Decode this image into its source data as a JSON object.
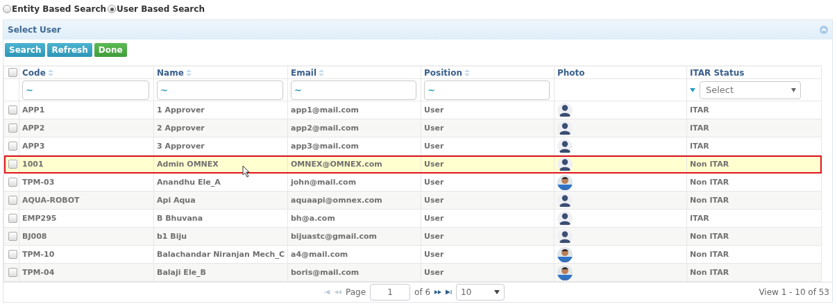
{
  "search_mode": [
    {
      "label": "Entity Based Search",
      "selected": false
    },
    {
      "label": "User Based Search",
      "selected": true
    }
  ],
  "panel": {
    "title": "Select User"
  },
  "buttons": [
    {
      "label": "Search",
      "kind": "primary"
    },
    {
      "label": "Refresh",
      "kind": "primary"
    },
    {
      "label": "Done",
      "kind": "success"
    }
  ],
  "table": {
    "select_all_checked": false,
    "columns": [
      {
        "label": "Code",
        "sortable": true,
        "kind": "text",
        "value": "~"
      },
      {
        "label": "Name",
        "sortable": true,
        "kind": "text",
        "value": "~"
      },
      {
        "label": "Email",
        "sortable": true,
        "kind": "text",
        "value": "~"
      },
      {
        "label": "Position",
        "sortable": true,
        "kind": "text",
        "value": "~"
      },
      {
        "label": "Photo",
        "sortable": false,
        "kind": "blank"
      },
      {
        "label": "ITAR Status",
        "sortable": false,
        "kind": "select",
        "placeholder": "Select"
      }
    ],
    "rows": [
      {
        "checked": false,
        "selected": false,
        "code": "APP1",
        "name": "1 Approver",
        "email": "app1@mail.com",
        "position": "User",
        "photo": {
          "kind": "avatar"
        },
        "itar": "ITAR"
      },
      {
        "checked": false,
        "selected": false,
        "code": "APP2",
        "name": "2 Approver",
        "email": "app2@mail.com",
        "position": "User",
        "photo": {
          "kind": "avatar"
        },
        "itar": "ITAR"
      },
      {
        "checked": false,
        "selected": false,
        "code": "APP3",
        "name": "3 Approver",
        "email": "app3@mail.com",
        "position": "User",
        "photo": {
          "kind": "avatar"
        },
        "itar": "ITAR"
      },
      {
        "checked": false,
        "selected": true,
        "code": "1001",
        "name": "Admin OMNEX",
        "email": "OMNEX@OMNEX.com",
        "position": "User",
        "photo": {
          "kind": "avatar"
        },
        "itar": "Non ITAR"
      },
      {
        "checked": false,
        "selected": false,
        "code": "TPM-03",
        "name": "Anandhu Ele_A",
        "email": "john@mail.com",
        "position": "User",
        "itar": "Non ITAR"
      },
      {
        "checked": false,
        "selected": false,
        "code": "AQUA-ROBOT",
        "name": "Api Aqua",
        "email": "aquaapi@omnex.com",
        "position": "User",
        "photo": {
          "kind": "avatar"
        },
        "itar": "Non ITAR"
      },
      {
        "checked": false,
        "selected": false,
        "code": "EMP295",
        "name": "B Bhuvana",
        "email": "bh@a.com",
        "position": "User",
        "photo": {
          "kind": "avatar"
        },
        "itar": "ITAR"
      },
      {
        "checked": false,
        "selected": false,
        "code": "BJ008",
        "name": "b1 Biju",
        "email": "bijuastc@gmail.com",
        "position": "User",
        "photo": {
          "kind": "avatar"
        },
        "itar": "Non ITAR"
      },
      {
        "checked": false,
        "selected": false,
        "code": "TPM-10",
        "name": "Balachandar Niranjan Mech_C",
        "email": "a4@mail.com",
        "position": "User",
        "itar": "Non ITAR"
      },
      {
        "checked": false,
        "selected": false,
        "code": "TPM-04",
        "name": "Balaji Ele_B",
        "email": "boris@mail.com",
        "position": "User",
        "itar": "Non ITAR"
      }
    ]
  },
  "pager": {
    "page_label": "Page",
    "page": "1",
    "of_pages": "of 6",
    "page_size": "10",
    "summary": "View 1 - 10 of 53"
  }
}
